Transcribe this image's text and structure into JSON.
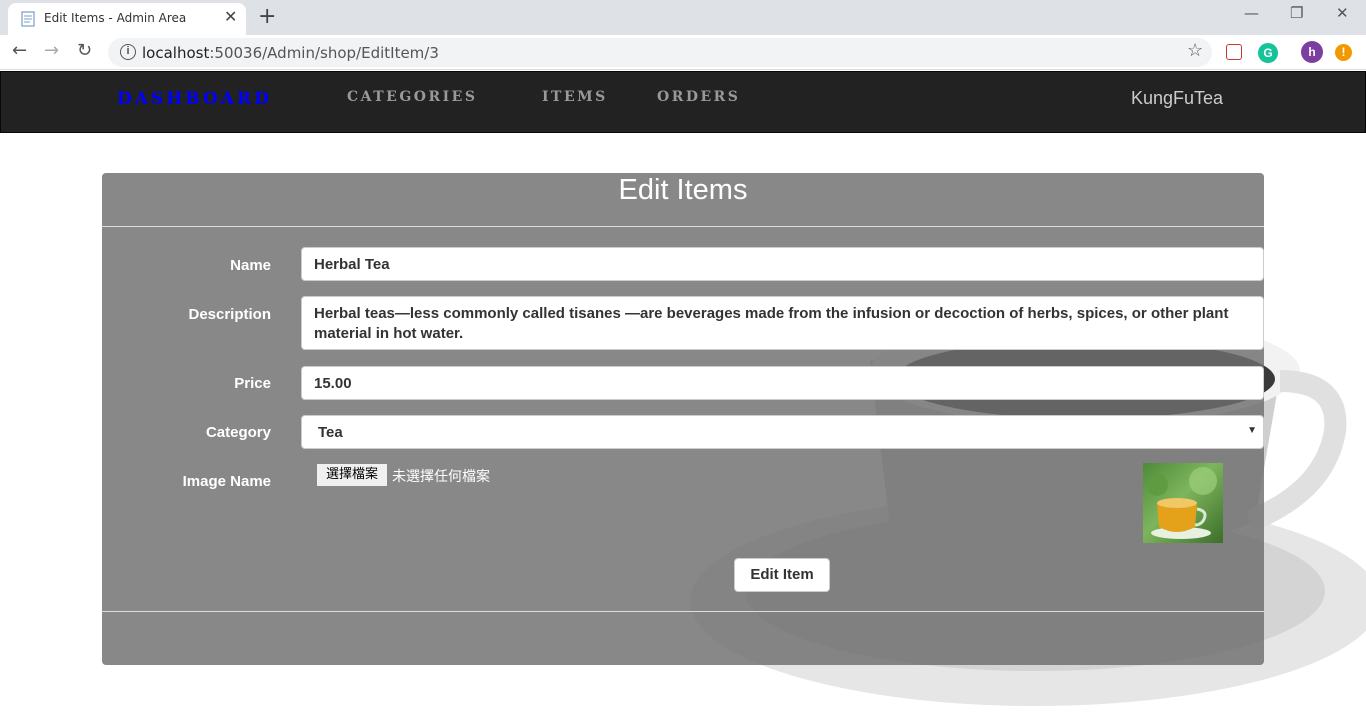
{
  "browser": {
    "tab_title": "Edit Items - Admin Area",
    "tab_close": "✕",
    "new_tab": "+",
    "url_host": "localhost",
    "url_path": ":50036/Admin/shop/EditItem/3",
    "profile_initial": "h",
    "alert_glyph": "!"
  },
  "navbar": {
    "brand": "DASHBOARD",
    "links": [
      "CATEGORIES",
      "ITEMS",
      "ORDERS"
    ],
    "site_name": "KungFuTea",
    "brand_color": "#0000ff"
  },
  "form": {
    "title": "Edit Items",
    "name_label": "Name",
    "name_value": "Herbal Tea",
    "description_label": "Description",
    "description_value": "Herbal teas—less commonly called tisanes —are beverages made from the infusion or decoction of herbs, spices, or other plant material in hot water.",
    "price_label": "Price",
    "price_value": "15.00",
    "category_label": "Category",
    "category_value": "Tea",
    "image_label": "Image Name",
    "file_button": "選擇檔案",
    "file_status": "未選擇任何檔案",
    "submit_label": "Edit Item"
  }
}
